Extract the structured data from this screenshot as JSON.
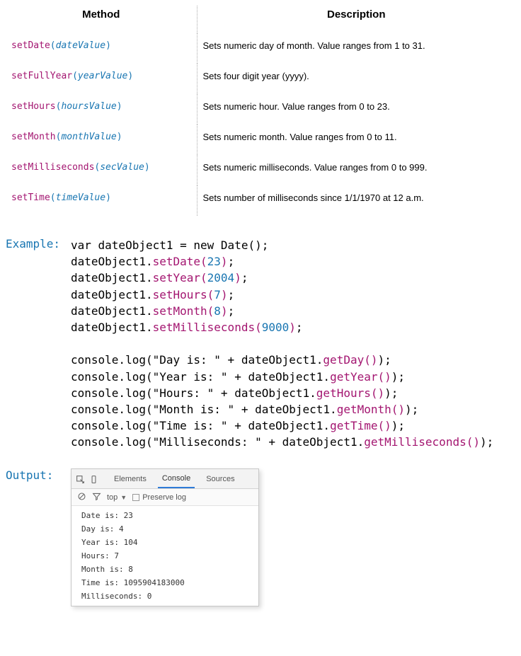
{
  "table": {
    "headers": {
      "method": "Method",
      "description": "Description"
    },
    "rows": [
      {
        "name": "setDate",
        "param": "dateValue",
        "desc": "Sets numeric day of month. Value ranges from 1 to 31."
      },
      {
        "name": "setFullYear",
        "param": "yearValue",
        "desc": "Sets four digit year (yyyy)."
      },
      {
        "name": "setHours",
        "param": "hoursValue",
        "desc": "Sets numeric hour. Value ranges from 0 to 23."
      },
      {
        "name": "setMonth",
        "param": "monthValue",
        "desc": "Sets numeric month. Value ranges from 0 to 11."
      },
      {
        "name": "setMilliseconds",
        "param": "secValue",
        "desc": "Sets numeric milliseconds. Value ranges from 0 to 999."
      },
      {
        "name": "setTime",
        "param": "timeValue",
        "desc": "Sets number of milliseconds since 1/1/1970 at 12 a.m."
      }
    ]
  },
  "example": {
    "label": "Example:",
    "var_decl": "var dateObject1 = new Date();",
    "obj": "dateObject1",
    "sets": [
      {
        "fn": "setDate",
        "arg": "23"
      },
      {
        "fn": "setYear",
        "arg": "2004"
      },
      {
        "fn": "setHours",
        "arg": "7"
      },
      {
        "fn": "setMonth",
        "arg": "8"
      },
      {
        "fn": "setMilliseconds",
        "arg": "9000"
      }
    ],
    "logs": [
      {
        "str": "\"Day is: \"",
        "fn": "getDay"
      },
      {
        "str": "\"Year is: \"",
        "fn": "getYear"
      },
      {
        "str": "\"Hours: \"",
        "fn": "getHours"
      },
      {
        "str": "\"Month is: \"",
        "fn": "getMonth"
      },
      {
        "str": "\"Time is: \"",
        "fn": "getTime"
      },
      {
        "str": "\"Milliseconds: \"",
        "fn": "getMilliseconds"
      }
    ]
  },
  "output": {
    "label": "Output:",
    "tabs": {
      "elements": "Elements",
      "console": "Console",
      "sources": "Sources"
    },
    "toolbar": {
      "scope": "top",
      "preserve": "Preserve log"
    },
    "lines": [
      "Date is: 23",
      "Day is: 4",
      "Year is: 104",
      "Hours: 7",
      "Month is: 8",
      "Time is: 1095904183000",
      "Milliseconds: 0"
    ]
  }
}
